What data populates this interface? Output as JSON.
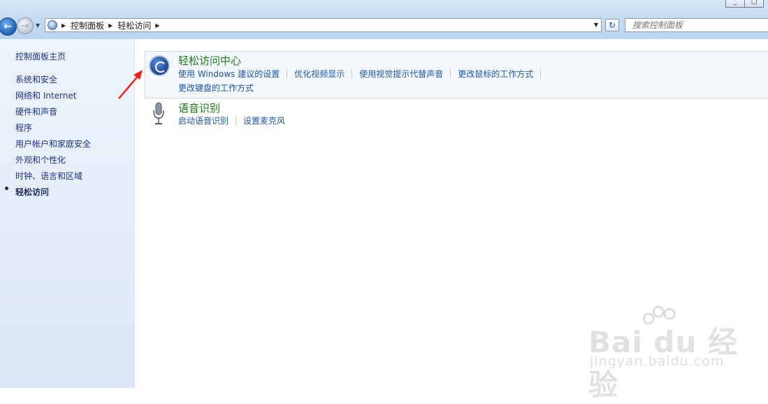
{
  "address_bar": {
    "breadcrumbs": [
      "控制面板",
      "轻松访问"
    ]
  },
  "search": {
    "placeholder": "搜索控制面板"
  },
  "sidebar": {
    "home_link": "控制面板主页",
    "items": [
      {
        "label": "系统和安全"
      },
      {
        "label": "网络和 Internet"
      },
      {
        "label": "硬件和声音"
      },
      {
        "label": "程序"
      },
      {
        "label": "用户帐户和家庭安全"
      },
      {
        "label": "外观和个性化"
      },
      {
        "label": "时钟、语言和区域"
      },
      {
        "label": "轻松访问",
        "current": true
      }
    ]
  },
  "main": {
    "categories": [
      {
        "title": "轻松访问中心",
        "icon": "ease-of-access-icon",
        "tasks": [
          "使用 Windows 建议的设置",
          "优化视频显示",
          "使用视觉提示代替声音",
          "更改鼠标的工作方式",
          "更改键盘的工作方式"
        ]
      },
      {
        "title": "语音识别",
        "icon": "microphone-icon",
        "tasks": [
          "启动语音识别",
          "设置麦克风"
        ]
      }
    ]
  },
  "watermark": {
    "brand": "Bai du 经验",
    "url": "jingyan.baidu.com"
  },
  "colors": {
    "link": "#1f56a8",
    "category_title": "#1d7a18",
    "annotation_arrow": "#e8231a"
  }
}
